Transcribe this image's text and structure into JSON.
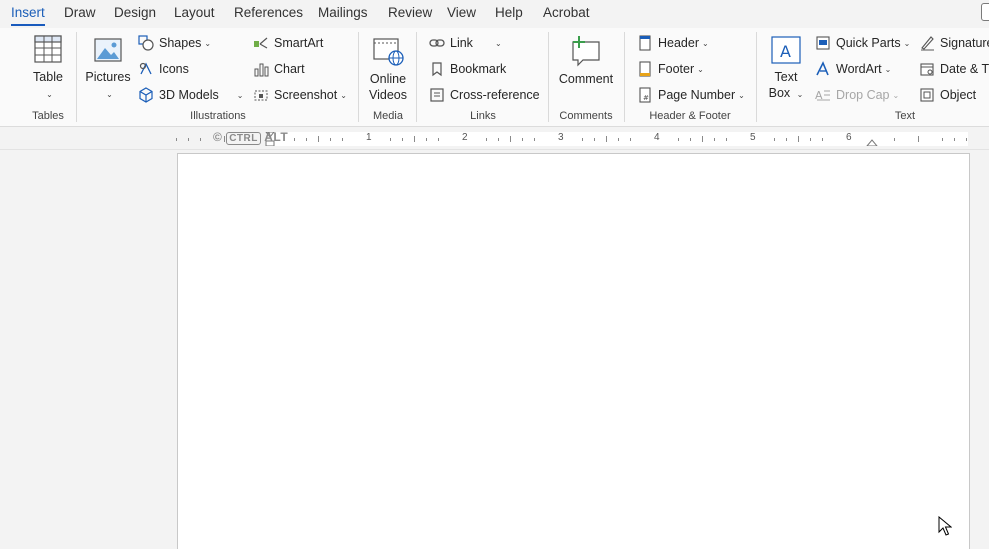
{
  "menu": {
    "tabs": [
      "Insert",
      "Draw",
      "Design",
      "Layout",
      "References",
      "Mailings",
      "Review",
      "View",
      "Help",
      "Acrobat"
    ],
    "active_tab": "Insert"
  },
  "ribbon": {
    "tables": {
      "table_label": "Table",
      "group_label": "Tables"
    },
    "illustrations": {
      "pictures_label": "Pictures",
      "shapes_label": "Shapes",
      "icons_label": "Icons",
      "models_label": "3D Models",
      "smartart_label": "SmartArt",
      "chart_label": "Chart",
      "screenshot_label": "Screenshot",
      "group_label": "Illustrations"
    },
    "media": {
      "online_videos_line1": "Online",
      "online_videos_line2": "Videos",
      "group_label": "Media"
    },
    "links": {
      "link_label": "Link",
      "bookmark_label": "Bookmark",
      "cross_reference_label": "Cross-reference",
      "group_label": "Links"
    },
    "comments": {
      "comment_label": "Comment",
      "group_label": "Comments"
    },
    "header_footer": {
      "header_label": "Header",
      "footer_label": "Footer",
      "page_number_label": "Page Number",
      "group_label": "Header & Footer"
    },
    "text": {
      "text_box_line1": "Text",
      "text_box_line2": "Box",
      "quick_parts_label": "Quick Parts",
      "wordart_label": "WordArt",
      "drop_cap_label": "Drop Cap",
      "signature_label": "Signature",
      "date_time_label": "Date & Ti",
      "object_label": "Object",
      "group_label": "Text"
    }
  },
  "ruler": {
    "numbers": [
      "1",
      "2",
      "3",
      "4",
      "5",
      "6"
    ],
    "watermark_prefix": "©",
    "watermark_box": "CTRL",
    "watermark_suffix": "ALT"
  },
  "colors": {
    "accent": "#185abd",
    "ribbon_bg": "#fafafa",
    "app_bg": "#f3f3f3"
  }
}
